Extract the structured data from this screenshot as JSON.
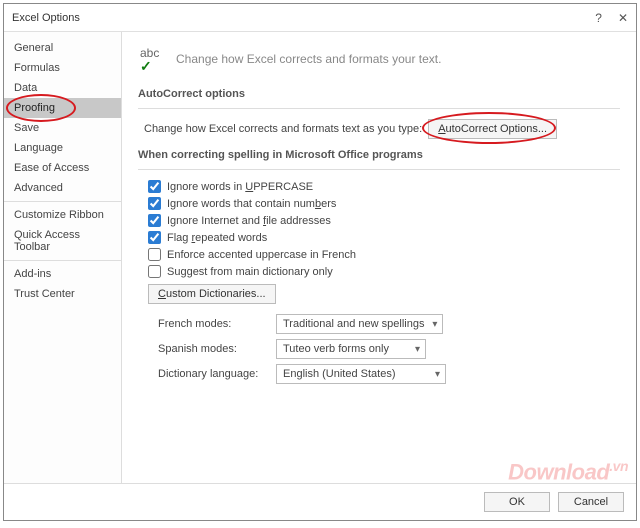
{
  "title": "Excel Options",
  "header_text": "Change how Excel corrects and formats your text.",
  "sidebar": {
    "items": [
      "General",
      "Formulas",
      "Data",
      "Proofing",
      "Save",
      "Language",
      "Ease of Access",
      "Advanced",
      "Customize Ribbon",
      "Quick Access Toolbar",
      "Add-ins",
      "Trust Center"
    ],
    "selected": "Proofing"
  },
  "sections": {
    "autocorrect_title": "AutoCorrect options",
    "autocorrect_line": "Change how Excel corrects and formats text as you type:",
    "autocorrect_button": "AutoCorrect Options...",
    "spelling_title": "When correcting spelling in Microsoft Office programs"
  },
  "checks": {
    "uppercase": {
      "label_pre": "Ignore words in ",
      "label_under": "U",
      "label_post": "PPERCASE",
      "checked": true
    },
    "numbers": {
      "label": "Ignore words that contain numbers",
      "under": "b",
      "checked": true
    },
    "internet": {
      "label_pre": "Ignore Internet and ",
      "label_under": "f",
      "label_post": "ile addresses",
      "checked": true
    },
    "flag": {
      "label_pre": "Flag ",
      "label_under": "r",
      "label_post": "epeated words",
      "checked": true
    },
    "french": {
      "label": "Enforce accented uppercase in French",
      "checked": false
    },
    "maindict": {
      "label": "Suggest from main dictionary only",
      "checked": false
    }
  },
  "custom_dict_button": "Custom Dictionaries...",
  "dropdowns": {
    "french_modes": {
      "label": "French modes:",
      "value": "Traditional and new spellings"
    },
    "spanish_modes": {
      "label": "Spanish modes:",
      "value": "Tuteo verb forms only"
    },
    "dict_lang": {
      "label": "Dictionary language:",
      "value": "English (United States)"
    }
  },
  "footer": {
    "ok": "OK",
    "cancel": "Cancel"
  },
  "watermark": "Download",
  "watermark_suffix": ".vn",
  "icons": {
    "abc": "abc"
  }
}
